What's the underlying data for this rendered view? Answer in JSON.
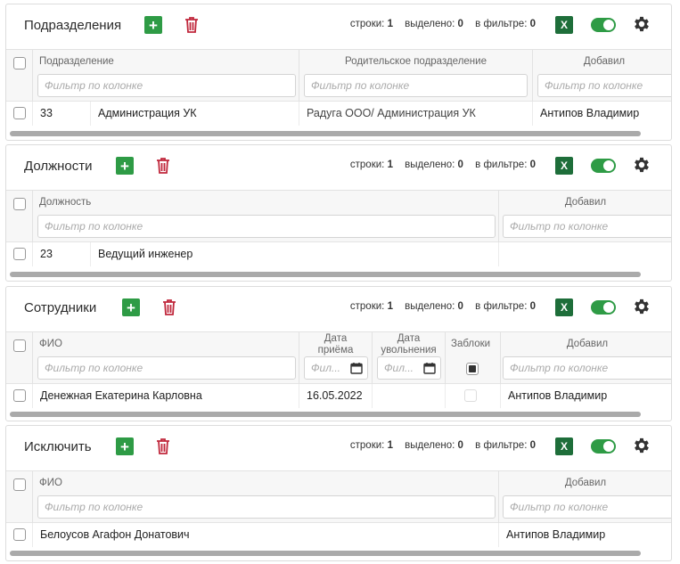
{
  "common": {
    "filter_placeholder": "Фильтр по колонке",
    "filter_placeholder_short": "Фил...",
    "stats_rows_label": "строки:",
    "stats_selected_label": "выделено:",
    "stats_filter_label": "в фильтре:",
    "excel_label": "X"
  },
  "panels": [
    {
      "title": "Подразделения",
      "stats": {
        "rows": "1",
        "selected": "0",
        "filter": "0"
      },
      "columns": [
        "Подразделение",
        "Родительское подразделение",
        "Добавил"
      ],
      "row": {
        "id": "33",
        "name": "Администрация УК",
        "parent": "Радуга ООО/ Администрация УК",
        "added_by": "Антипов Владимир"
      }
    },
    {
      "title": "Должности",
      "stats": {
        "rows": "1",
        "selected": "0",
        "filter": "0"
      },
      "columns": [
        "Должность",
        "Добавил"
      ],
      "row": {
        "id": "23",
        "name": "Ведущий инженер",
        "added_by": ""
      }
    },
    {
      "title": "Сотрудники",
      "stats": {
        "rows": "1",
        "selected": "0",
        "filter": "0"
      },
      "columns": [
        "ФИО",
        "Дата приёма",
        "Дата увольнения",
        "Заблоки",
        "Добавил"
      ],
      "row": {
        "fio": "Денежная Екатерина Карловна",
        "hire_date": "16.05.2022",
        "fire_date": "",
        "blocked": false,
        "added_by": "Антипов Владимир"
      }
    },
    {
      "title": "Исключить",
      "stats": {
        "rows": "1",
        "selected": "0",
        "filter": "0"
      },
      "columns": [
        "ФИО",
        "Добавил"
      ],
      "row": {
        "fio": "Белоусов Агафон Донатович",
        "added_by": "Антипов Владимир"
      }
    }
  ],
  "colors": {
    "add": "#2e9b45",
    "delete": "#c0283c",
    "excel": "#1e6e3a",
    "toggle": "#2e9b45"
  },
  "icons": [
    "plus-icon",
    "trash-icon",
    "excel-icon",
    "toggle-switch",
    "gear-icon",
    "calendar-icon",
    "checkbox"
  ]
}
